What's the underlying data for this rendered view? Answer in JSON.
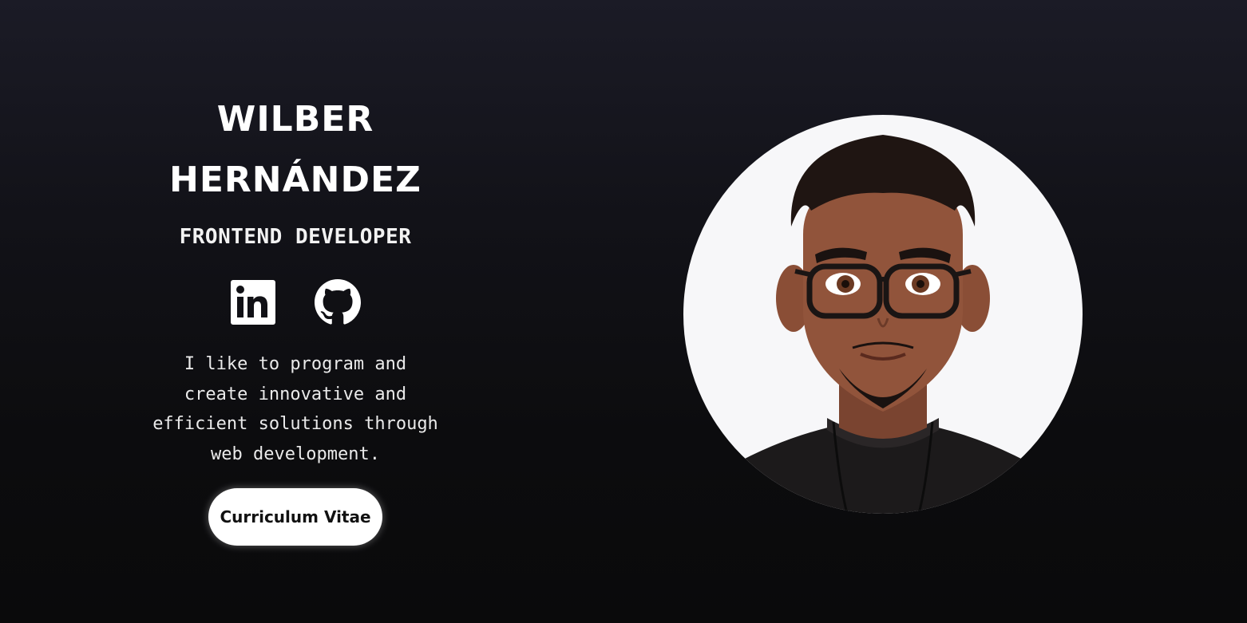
{
  "profile": {
    "name_line1": "WILBER",
    "name_line2": "HERNÁNDEZ",
    "role": "FRONTEND DEVELOPER",
    "bio": "I like to program and create innovative and efficient solutions through web development.",
    "cv_button_label": "Curriculum Vitae"
  },
  "socials": [
    {
      "icon": "linkedin-icon",
      "label": "LinkedIn"
    },
    {
      "icon": "github-icon",
      "label": "GitHub"
    }
  ],
  "avatar": {
    "icon": "avatar-illustration",
    "background_color": "#f7f7f9"
  },
  "colors": {
    "background_top": "#1b1b26",
    "background_bottom": "#0a0a0b",
    "text": "#ffffff",
    "button_bg": "#ffffff",
    "button_text": "#111111"
  }
}
